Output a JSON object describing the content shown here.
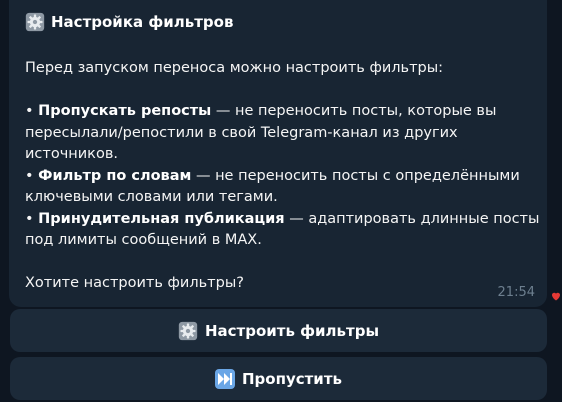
{
  "message": {
    "title_icon": "gear-icon",
    "title": "Настройка фильтров",
    "intro": "Перед запуском переноса можно настроить фильтры:",
    "items": [
      {
        "bullet": "• ",
        "name": "Пропускать репосты",
        "desc": " — не переносить посты, которые вы пересылали/репостили в свой Telegram-канал из других источников."
      },
      {
        "bullet": "• ",
        "name": "Фильтр по словам",
        "desc": " — не переносить посты с определёнными ключевыми словами или тегами."
      },
      {
        "bullet": "• ",
        "name": "Принудительная публикация",
        "desc": " — адаптировать длинные посты под лимиты сообщений в MAX."
      }
    ],
    "question": "Хотите настроить фильтры?",
    "time": "21:54",
    "reaction_icon": "heart-icon"
  },
  "keyboard": {
    "configure": {
      "icon": "gear-icon",
      "label": "Настроить фильтры"
    },
    "skip": {
      "icon": "next-track-icon",
      "label": "Пропустить"
    }
  },
  "colors": {
    "background": "#0e1621",
    "bubble": "#182533",
    "button": "#1c2a39",
    "time": "#6d7f8f",
    "reaction": "#e53935",
    "skip_icon": "#6aa6e6"
  }
}
